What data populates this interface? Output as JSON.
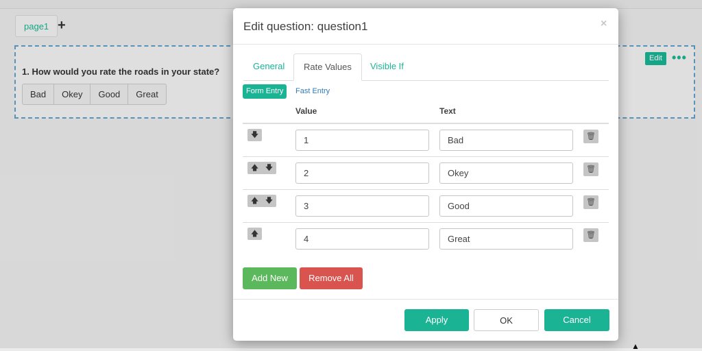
{
  "background": {
    "page_tab": "page1",
    "add_page_icon": "plus-icon",
    "question_title": "1. How would you rate the roads in your state?",
    "rating_options": [
      "Bad",
      "Okey",
      "Good",
      "Great"
    ],
    "edit_label": "Edit",
    "more_icon": "ellipsis-icon"
  },
  "modal": {
    "title": "Edit question: question1",
    "close_icon": "×",
    "tabs": [
      {
        "label": "General",
        "active": false
      },
      {
        "label": "Rate Values",
        "active": true
      },
      {
        "label": "Visible If",
        "active": false
      }
    ],
    "entry_modes": {
      "form_entry": "Form Entry",
      "fast_entry": "Fast Entry",
      "selected": "Form Entry"
    },
    "columns": {
      "value": "Value",
      "text": "Text"
    },
    "rows": [
      {
        "value": "1",
        "text": "Bad",
        "arrows": [
          "down"
        ]
      },
      {
        "value": "2",
        "text": "Okey",
        "arrows": [
          "up",
          "down"
        ]
      },
      {
        "value": "3",
        "text": "Good",
        "arrows": [
          "up",
          "down"
        ]
      },
      {
        "value": "4",
        "text": "Great",
        "arrows": [
          "up"
        ]
      }
    ],
    "add_new": "Add New",
    "remove_all": "Remove All",
    "apply": "Apply",
    "ok": "OK",
    "cancel": "Cancel"
  },
  "colors": {
    "accent": "#1ab394",
    "danger": "#d9534f",
    "success": "#5cb85c",
    "link": "#337ab7"
  }
}
